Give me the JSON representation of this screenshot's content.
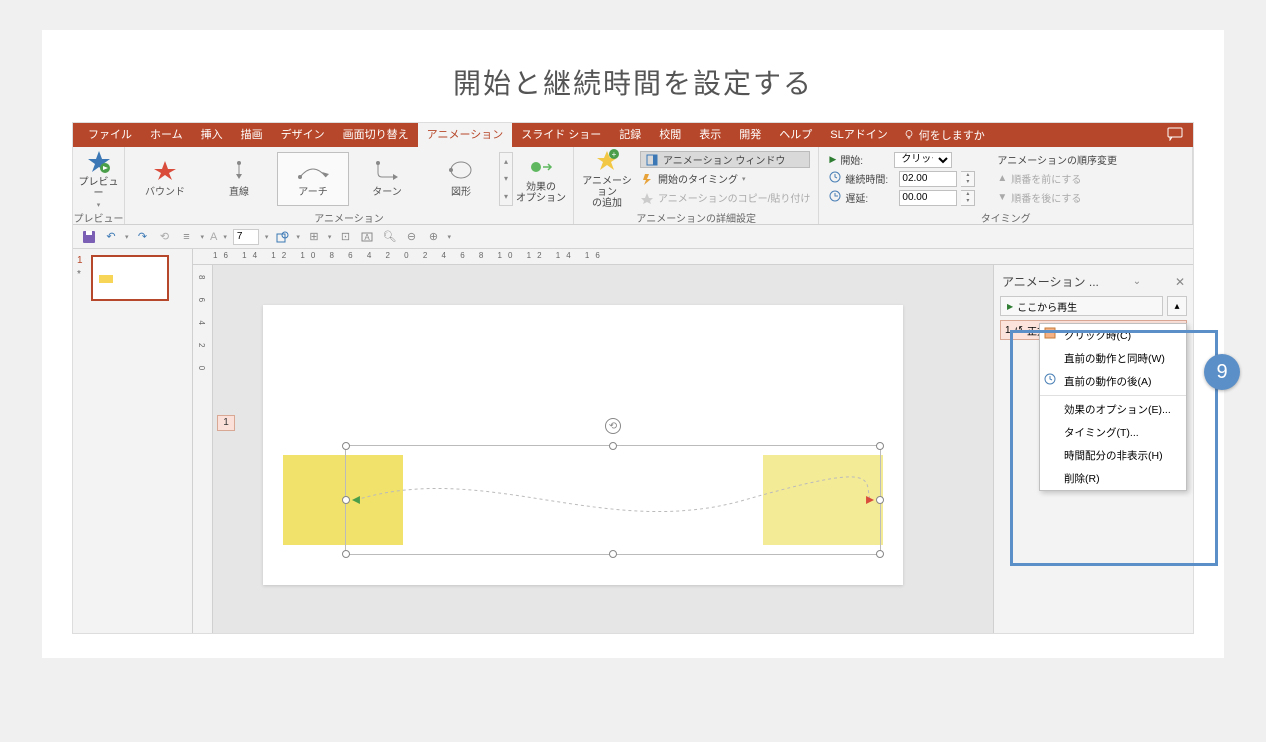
{
  "page_title": "開始と継続時間を設定する",
  "tabs": [
    "ファイル",
    "ホーム",
    "挿入",
    "描画",
    "デザイン",
    "画面切り替え",
    "アニメーション",
    "スライド ショー",
    "記録",
    "校閲",
    "表示",
    "開発",
    "ヘルプ",
    "SLアドイン"
  ],
  "active_tab_index": 6,
  "tell_me": "何をしますか",
  "ribbon": {
    "preview": {
      "label": "プレビュー",
      "group": "プレビュー"
    },
    "gallery": {
      "items": [
        "バウンド",
        "直線",
        "アーチ",
        "ターン",
        "図形"
      ],
      "selected_index": 2,
      "group": "アニメーション"
    },
    "effect_options": "効果の\nオプション",
    "add_anim": "アニメーション\nの追加",
    "adv": {
      "pane_btn": "アニメーション ウィンドウ",
      "trigger": "開始のタイミング",
      "painter": "アニメーションのコピー/貼り付け",
      "group": "アニメーションの詳細設定"
    },
    "timing": {
      "start_label": "開始:",
      "start_value": "クリック時",
      "duration_label": "継続時間:",
      "duration_value": "02.00",
      "delay_label": "遅延:",
      "delay_value": "00.00",
      "reorder": "アニメーションの順序変更",
      "earlier": "順番を前にする",
      "later": "順番を後にする",
      "group": "タイミング"
    }
  },
  "qat_font_size": "7",
  "ruler": "16 14 12 10 8 6 4 2 0 2 4 6 8 10 12 14 16",
  "thumb": {
    "num": "1",
    "star": "*"
  },
  "slide_tag": "1",
  "pane": {
    "title": "アニメーション ...",
    "play": "ここから再生",
    "item_seq": "1",
    "item_name": "正方形/長方形",
    "menu": [
      "クリック時(C)",
      "直前の動作と同時(W)",
      "直前の動作の後(A)",
      "効果のオプション(E)...",
      "タイミング(T)...",
      "時間配分の非表示(H)",
      "削除(R)"
    ]
  },
  "callout_num": "9"
}
